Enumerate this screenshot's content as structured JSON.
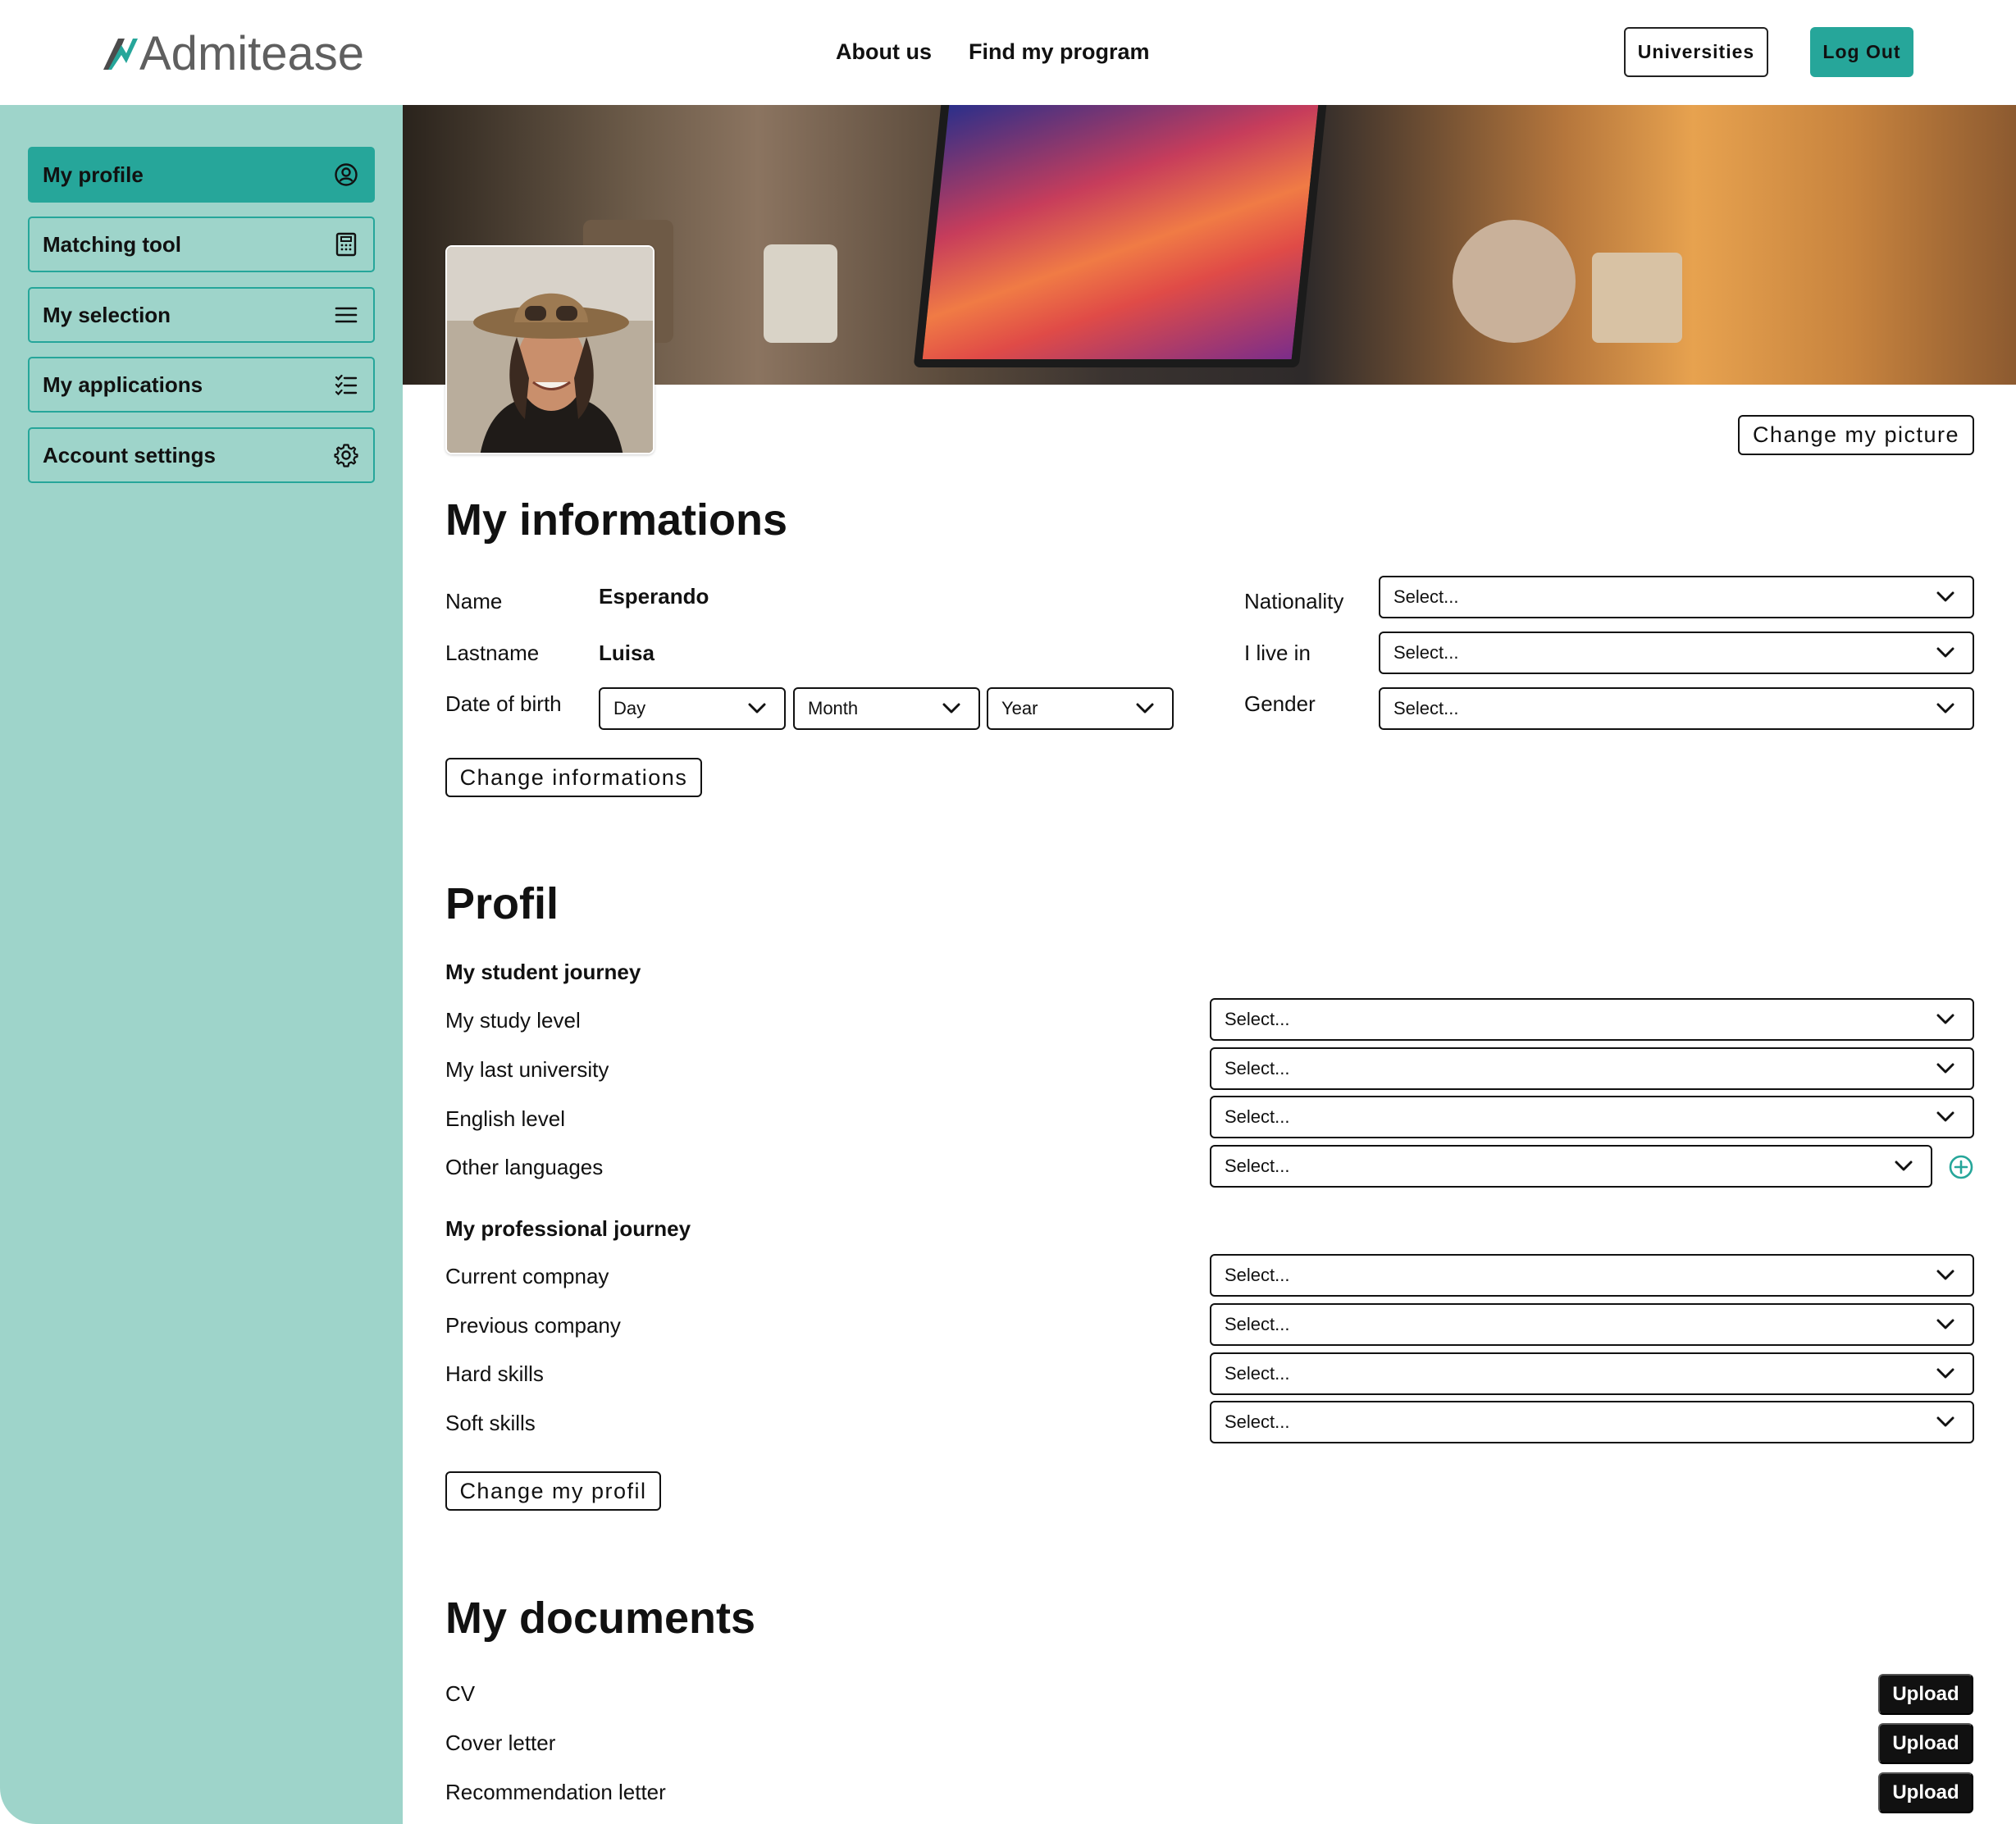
{
  "header": {
    "logo": "Admitease",
    "nav": {
      "about": "About us",
      "find": "Find my program"
    },
    "universities_label": "Universities",
    "logout_label": "Log Out"
  },
  "sidebar": {
    "items": [
      {
        "label": "My profile",
        "icon": "user-circle-icon",
        "active": true
      },
      {
        "label": "Matching tool",
        "icon": "calculator-icon",
        "active": false
      },
      {
        "label": "My selection",
        "icon": "menu-icon",
        "active": false
      },
      {
        "label": "My applications",
        "icon": "checklist-icon",
        "active": false
      },
      {
        "label": "Account settings",
        "icon": "gear-icon",
        "active": false
      }
    ]
  },
  "profile_picture": {
    "change_label": "Change my picture"
  },
  "informations": {
    "title": "My informations",
    "name_label": "Name",
    "name_value": "Esperando",
    "lastname_label": "Lastname",
    "lastname_value": "Luisa",
    "dob_label": "Date of birth",
    "dob_day": "Day",
    "dob_month": "Month",
    "dob_year": "Year",
    "nationality_label": "Nationality",
    "nationality_value": "Select...",
    "live_label": "I live in",
    "live_value": "Select...",
    "gender_label": "Gender",
    "gender_value": "Select...",
    "change_label": "Change informations"
  },
  "profil": {
    "title": "Profil",
    "student_heading": "My student journey",
    "study_level_label": "My study level",
    "study_level_value": "Select...",
    "last_university_label": "My last university",
    "last_university_value": "Select...",
    "english_level_label": "English level",
    "english_level_value": "Select...",
    "other_languages_label": "Other languages",
    "other_languages_value": "Select...",
    "professional_heading": "My professional journey",
    "current_company_label": "Current compnay",
    "current_company_value": "Select...",
    "previous_company_label": "Previous company",
    "previous_company_value": "Select...",
    "hard_skills_label": "Hard skills",
    "hard_skills_value": "Select...",
    "soft_skills_label": "Soft skills",
    "soft_skills_value": "Select...",
    "change_label": "Change my profil"
  },
  "documents": {
    "title": "My documents",
    "items": [
      {
        "label": "CV",
        "action": "Upload"
      },
      {
        "label": "Cover letter",
        "action": "Upload"
      },
      {
        "label": "Recommendation letter",
        "action": "Upload"
      }
    ]
  },
  "colors": {
    "accent": "#26a69a",
    "sidebar_bg": "#9ed4ca"
  }
}
